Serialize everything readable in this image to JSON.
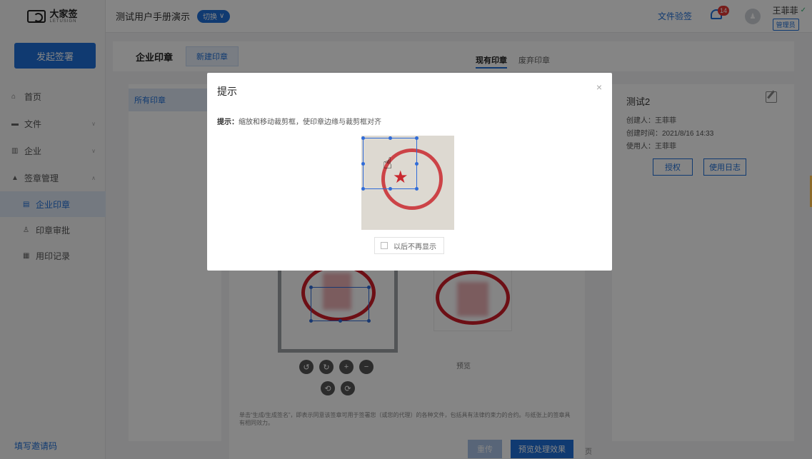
{
  "brand": {
    "name": "大家签",
    "sub": "LETUSIGN"
  },
  "sidebar": {
    "start_button": "发起签署",
    "items": [
      {
        "icon": "home-icon",
        "glyph": "⌂",
        "label": "首页"
      },
      {
        "icon": "folder-icon",
        "glyph": "▬",
        "label": "文件"
      },
      {
        "icon": "building-icon",
        "glyph": "▥",
        "label": "企业"
      },
      {
        "icon": "user-icon",
        "glyph": "▲",
        "label": "签章管理"
      },
      {
        "icon": "doc-icon",
        "glyph": "▤",
        "label": "企业印章"
      },
      {
        "icon": "person-icon",
        "glyph": "♙",
        "label": "印章审批"
      },
      {
        "icon": "record-icon",
        "glyph": "▦",
        "label": "用印记录"
      }
    ],
    "invite": "填写邀请码"
  },
  "header": {
    "company": "测试用户手册演示",
    "switch_label": "切换",
    "verify_link": "文件验签",
    "notification_count": "14",
    "user_name": "王菲菲",
    "role": "管理员"
  },
  "tabbar": {
    "title": "企业印章",
    "new_seal": "新建印章",
    "tabs": [
      "现有印章",
      "废弃印章"
    ]
  },
  "left_panel": {
    "filter": "所有印章"
  },
  "right_panel": {
    "seal_name": "测试2",
    "creator": "创建人：王菲菲",
    "created_time": "创建时间：2021/8/16 14:33",
    "user": "使用人：王菲菲",
    "authorize": "授权",
    "usage_log": "使用日志"
  },
  "editor": {
    "preview_label": "预览",
    "disclaimer": "单击“生成/生成签名”，即表示同意该签章可用于签署您（或您的代理）的各种文件，包括具有法律约束力的合约。与纸张上的签章具有相同效力。",
    "back_button": "重传",
    "preview_button": "预览处理效果",
    "page_hint": "页"
  },
  "modal": {
    "title": "提示",
    "tip_label": "提示：",
    "tip_text": "缩放和移动裁剪框，使印章边缘与裁剪框对齐",
    "dont_show": "以后不再显示"
  },
  "colors": {
    "accent": "#1f6fd8",
    "seal_red": "#d21d2a",
    "badge": "#e53935"
  }
}
